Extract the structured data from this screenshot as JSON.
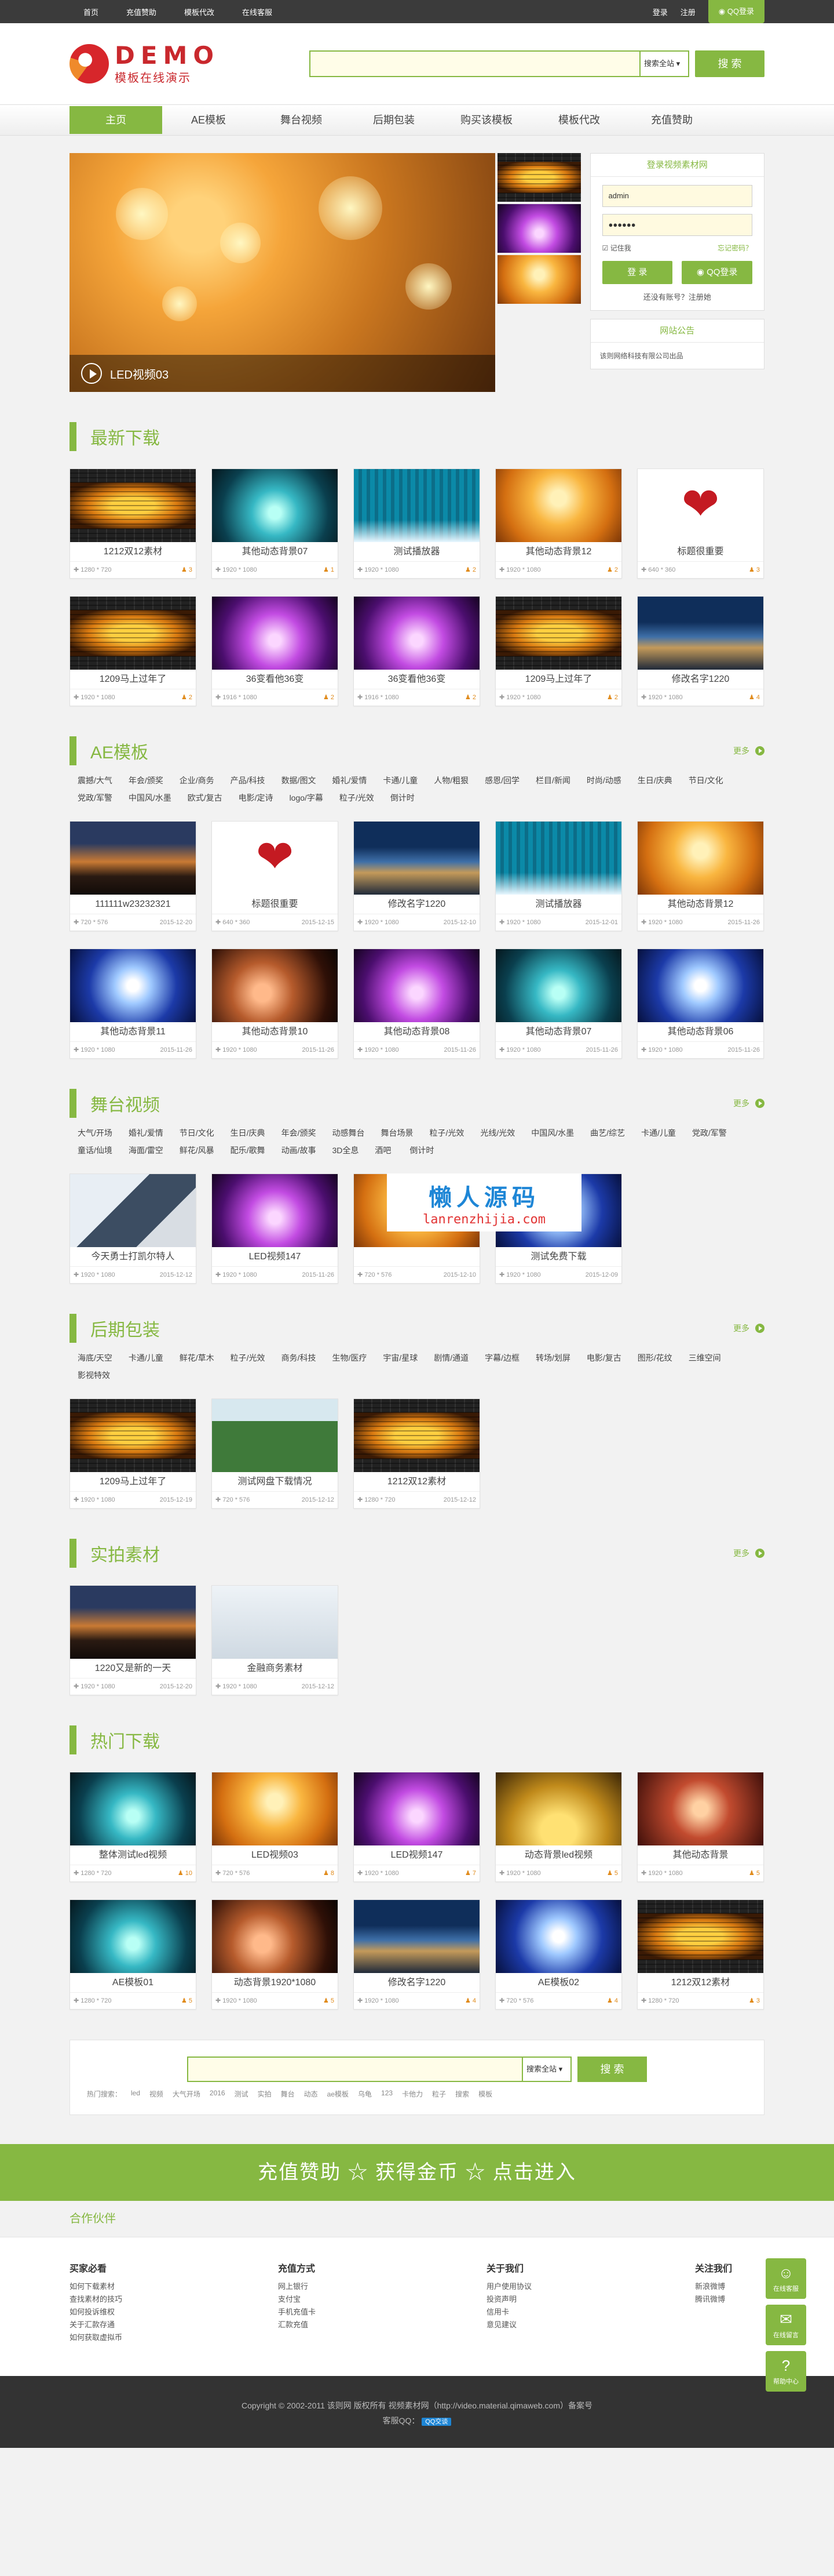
{
  "topbar": {
    "links": [
      "首页",
      "充值赞助",
      "模板代改",
      "在线客服"
    ],
    "login": "登录",
    "register": "注册",
    "qq_login": "QQ登录"
  },
  "logo": {
    "big": "DEMO",
    "small": "模板在线演示"
  },
  "search": {
    "placeholder": "",
    "scope": "搜索全站",
    "button": "搜 索"
  },
  "nav": [
    "主页",
    "AE模板",
    "舞台视频",
    "后期包装",
    "购买该模板",
    "模板代改",
    "充值赞助"
  ],
  "slider": {
    "caption": "LED视频03"
  },
  "login": {
    "title": "登录视频素材网",
    "username": "admin",
    "password": "●●●●●●",
    "remember": "记住我",
    "forgot": "忘记密码？",
    "login_btn": "登 录",
    "qq_btn": "QQ登录",
    "register_text": "还没有账号？注册她"
  },
  "notice": {
    "title": "网站公告",
    "text": "该则网络科技有限公司出品"
  },
  "sections": {
    "latest": {
      "title": "最新下载",
      "items": [
        {
          "name": "1212双12素材",
          "size": "1280 * 720",
          "count": "3",
          "img": "i-led"
        },
        {
          "name": "其他动态背景07",
          "size": "1920 * 1080",
          "count": "1",
          "img": "i-teal"
        },
        {
          "name": "测试播放器",
          "size": "1920 * 1080",
          "count": "2",
          "img": "i-curtain"
        },
        {
          "name": "其他动态背景12",
          "size": "1920 * 1080",
          "count": "2",
          "img": "i-orange"
        },
        {
          "name": "标题很重要",
          "size": "640 * 360",
          "count": "3",
          "img": "i-heart"
        },
        {
          "name": "1209马上过年了",
          "size": "1920 * 1080",
          "count": "2",
          "img": "i-led"
        },
        {
          "name": "36变看他36变",
          "size": "1916 * 1080",
          "count": "2",
          "img": "i-purple"
        },
        {
          "name": "36变看他36变",
          "size": "1916 * 1080",
          "count": "2",
          "img": "i-purple"
        },
        {
          "name": "1209马上过年了",
          "size": "1920 * 1080",
          "count": "2",
          "img": "i-led"
        },
        {
          "name": "修改名字1220",
          "size": "1920 * 1080",
          "count": "4",
          "img": "i-city"
        }
      ]
    },
    "ae": {
      "title": "AE模板",
      "more": "更多",
      "tags": [
        "震撼/大气",
        "年会/颁奖",
        "企业/商务",
        "产品/科技",
        "数据/图文",
        "婚礼/爱情",
        "卡通/儿童",
        "人物/粗狠",
        "感恩/回学",
        "栏目/新闻",
        "时尚/动感",
        "生日/庆典",
        "节日/文化",
        "党政/军警",
        "中国风/水墨",
        "欧式/复古",
        "电影/定诗",
        "logo/字幕",
        "粒子/光效",
        "倒计时"
      ],
      "items": [
        {
          "name": "111111w23232321",
          "size": "720 * 576",
          "date": "2015-12-20",
          "img": "i-sunset"
        },
        {
          "name": "标题很重要",
          "size": "640 * 360",
          "date": "2015-12-15",
          "img": "i-heart"
        },
        {
          "name": "修改名字1220",
          "size": "1920 * 1080",
          "date": "2015-12-10",
          "img": "i-city"
        },
        {
          "name": "测试播放器",
          "size": "1920 * 1080",
          "date": "2015-12-01",
          "img": "i-curtain"
        },
        {
          "name": "其他动态背景12",
          "size": "1920 * 1080",
          "date": "2015-11-26",
          "img": "i-orange"
        },
        {
          "name": "其他动态背景11",
          "size": "1920 * 1080",
          "date": "2015-11-26",
          "img": "i-blue"
        },
        {
          "name": "其他动态背景10",
          "size": "1920 * 1080",
          "date": "2015-11-26",
          "img": "i-spark"
        },
        {
          "name": "其他动态背景08",
          "size": "1920 * 1080",
          "date": "2015-11-26",
          "img": "i-purple"
        },
        {
          "name": "其他动态背景07",
          "size": "1920 * 1080",
          "date": "2015-11-26",
          "img": "i-teal"
        },
        {
          "name": "其他动态背景06",
          "size": "1920 * 1080",
          "date": "2015-11-26",
          "img": "i-blue"
        }
      ]
    },
    "stage": {
      "title": "舞台视频",
      "more": "更多",
      "tags": [
        "大气/开场",
        "婚礼/爱情",
        "节日/文化",
        "生日/庆典",
        "年会/颁奖",
        "动感舞台",
        "舞台场景",
        "粒子/光效",
        "光线/光效",
        "中国风/水墨",
        "曲艺/综艺",
        "卡通/儿童",
        "党政/军警",
        "童话/仙境",
        "海面/雷空",
        "鲜花/风暴",
        "配乐/歌舞",
        "动画/故事",
        "3D全息",
        "酒吧",
        "倒计时"
      ],
      "items": [
        {
          "name": "今天勇士打凯尔特人",
          "size": "1920 * 1080",
          "date": "2015-12-12",
          "img": "i-office"
        },
        {
          "name": "LED视频147",
          "size": "1920 * 1080",
          "date": "2015-11-26",
          "img": "i-purple"
        },
        {
          "name": "",
          "size": "720 * 576",
          "date": "2015-12-10",
          "img": "i-orange"
        },
        {
          "name": "测试免费下载",
          "size": "1920 * 1080",
          "date": "2015-12-09",
          "img": "i-blue"
        }
      ]
    },
    "post": {
      "title": "后期包装",
      "more": "更多",
      "tags": [
        "海底/天空",
        "卡通/儿童",
        "鲜花/草木",
        "粒子/光效",
        "商务/科技",
        "生物/医疗",
        "宇宙/星球",
        "剧情/通道",
        "字幕/边框",
        "转场/划屏",
        "电影/复古",
        "图形/花纹",
        "三维空间",
        "影视特效"
      ],
      "items": [
        {
          "name": "1209马上过年了",
          "size": "1920 * 1080",
          "date": "2015-12-19",
          "img": "i-led"
        },
        {
          "name": "测试网盘下载情况",
          "size": "720 * 576",
          "date": "2015-12-12",
          "img": "i-green"
        },
        {
          "name": "1212双12素材",
          "size": "1280 * 720",
          "date": "2015-12-12",
          "img": "i-led"
        }
      ]
    },
    "shoot": {
      "title": "实拍素材",
      "more": "更多",
      "items": [
        {
          "name": "1220又是新的一天",
          "size": "1920 * 1080",
          "date": "2015-12-20",
          "img": "i-sunset"
        },
        {
          "name": "金融商务素材",
          "size": "1920 * 1080",
          "date": "2015-12-12",
          "img": "i-white"
        }
      ]
    },
    "hot": {
      "title": "热门下载",
      "items": [
        {
          "name": "整体测试led视频",
          "size": "1280 * 720",
          "count": "10",
          "img": "i-teal"
        },
        {
          "name": "LED视频03",
          "size": "720 * 576",
          "count": "8",
          "img": "i-orange"
        },
        {
          "name": "LED视频147",
          "size": "1920 * 1080",
          "count": "7",
          "img": "i-purple"
        },
        {
          "name": "动态背景led视频",
          "size": "1920 * 1080",
          "count": "5",
          "img": "i-gold"
        },
        {
          "name": "其他动态背景",
          "size": "1920 * 1080",
          "count": "5",
          "img": "i-red"
        },
        {
          "name": "AE模板01",
          "size": "1280 * 720",
          "count": "5",
          "img": "i-teal"
        },
        {
          "name": "动态背景1920*1080",
          "size": "1920 * 1080",
          "count": "5",
          "img": "i-spark"
        },
        {
          "name": "修改名字1220",
          "size": "1920 * 1080",
          "count": "4",
          "img": "i-city"
        },
        {
          "name": "AE模板02",
          "size": "720 * 576",
          "count": "4",
          "img": "i-blue"
        },
        {
          "name": "1212双12素材",
          "size": "1280 * 720",
          "count": "3",
          "img": "i-led"
        }
      ]
    }
  },
  "watermark": {
    "line1": "懒人源码",
    "line2": "lanrenzhijia.com"
  },
  "bottom_search": {
    "scope": "搜索全站",
    "button": "搜 索",
    "hot_label": "热门搜索：",
    "hot": [
      "led",
      "视频",
      "大气开场",
      "2016",
      "测试",
      "实拍",
      "舞台",
      "动态",
      "ae模板",
      "乌龟",
      "123",
      "卡他力",
      "粒子",
      "搜索",
      "模板"
    ]
  },
  "banner": "充值赞助 ☆ 获得金币 ☆ 点击进入",
  "partner": "合作伙伴",
  "footer": {
    "cols": [
      {
        "title": "买家必看",
        "links": [
          "如何下载素材",
          "查找素材的技巧",
          "如何投诉维权",
          "关于汇款存通",
          "如何获取虚拟币"
        ]
      },
      {
        "title": "充值方式",
        "links": [
          "网上银行",
          "支付宝",
          "手机充值卡",
          "汇款充值"
        ]
      },
      {
        "title": "关于我们",
        "links": [
          "用户使用协议",
          "投资声明",
          "信用卡",
          "意见建议"
        ]
      },
      {
        "title": "关注我们",
        "links": [
          "新浪微博",
          "腾讯微博"
        ]
      }
    ],
    "side": [
      "在线客服",
      "在线留言",
      "帮助中心"
    ]
  },
  "copyright": {
    "line1": "Copyright © 2002-2011 该则网 版权所有 视频素材网（http://video.material.qimaweb.com）备案号",
    "line2": "客服QQ："
  }
}
